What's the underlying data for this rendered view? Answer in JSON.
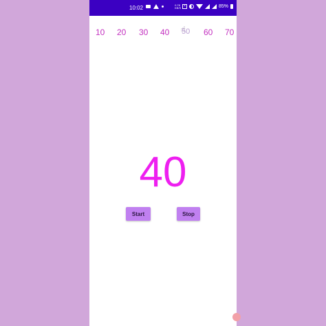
{
  "status_bar": {
    "time": "10:02",
    "speed": "0.78 KB/S",
    "battery": "85%",
    "background_color": "#3b00c2"
  },
  "picker": {
    "items": [
      "10",
      "20",
      "30",
      "40",
      "50",
      "60",
      "70"
    ],
    "selected_index": 4,
    "text_color": "#c22fbf",
    "selected_overlay_icon": "touch-hand-icon"
  },
  "display": {
    "value": "40",
    "color": "#ee1ff0"
  },
  "controls": {
    "start_label": "Start",
    "stop_label": "Stop",
    "button_color": "#c080f0"
  },
  "background_color": "#d1a7da"
}
